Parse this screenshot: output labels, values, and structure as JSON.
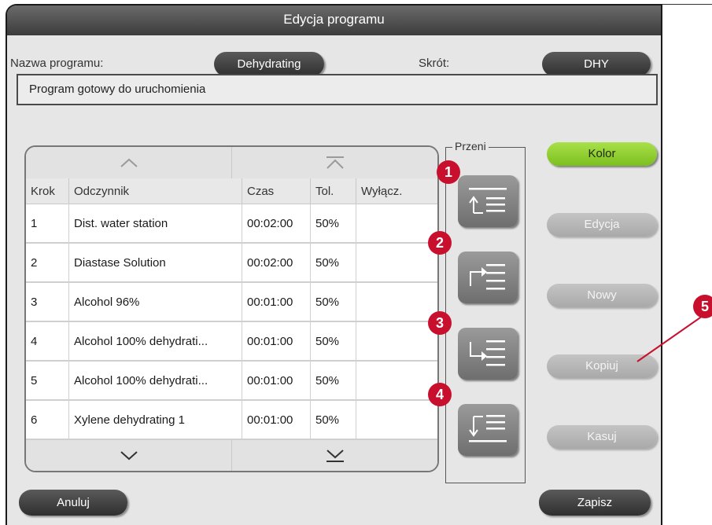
{
  "window": {
    "title": "Edycja programu"
  },
  "program": {
    "name_label": "Nazwa programu:",
    "name_value": "Dehydrating",
    "abbr_label": "Skrót:",
    "abbr_value": "DHY",
    "status": "Program gotowy do uruchomienia"
  },
  "table": {
    "headers": [
      "Krok",
      "Odczynnik",
      "Czas",
      "Tol.",
      "Wyłącz."
    ],
    "rows": [
      [
        "1",
        "Dist. water station",
        "00:02:00",
        "50%",
        ""
      ],
      [
        "2",
        "Diastase Solution",
        "00:02:00",
        "50%",
        ""
      ],
      [
        "3",
        "Alcohol 96%",
        "00:01:00",
        "50%",
        ""
      ],
      [
        "4",
        "Alcohol 100% dehydrati...",
        "00:01:00",
        "50%",
        ""
      ],
      [
        "5",
        "Alcohol 100% dehydrati...",
        "00:01:00",
        "50%",
        ""
      ],
      [
        "6",
        "Xylene dehydrating 1",
        "00:01:00",
        "50%",
        ""
      ]
    ],
    "nav_icons": [
      "chevron-up-icon",
      "double-chevron-up-icon",
      "chevron-down-icon",
      "double-chevron-down-icon"
    ]
  },
  "move_group": {
    "legend": "Przeni",
    "buttons": [
      {
        "callout": "1",
        "icon": "insert-step-above-icon"
      },
      {
        "callout": "2",
        "icon": "insert-step-after-icon"
      },
      {
        "callout": "3",
        "icon": "insert-step-before-icon"
      },
      {
        "callout": "4",
        "icon": "insert-step-below-icon"
      }
    ]
  },
  "side_buttons": {
    "color": "Kolor",
    "edit": "Edycja",
    "new": "Nowy",
    "copy": "Kopiuj",
    "delete": "Kasuj"
  },
  "bottom": {
    "cancel": "Anuluj",
    "save": "Zapisz"
  },
  "annotation": {
    "callout_5": "5"
  },
  "colors": {
    "accent_green": "#8fcf2c",
    "callout_red": "#c8102e",
    "dark_button": "#3a3a3a"
  }
}
